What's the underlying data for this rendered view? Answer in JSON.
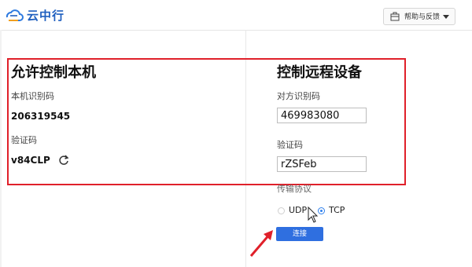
{
  "app": {
    "title": "云中行",
    "help_label": "帮助与反馈"
  },
  "local": {
    "section_title": "允许控制本机",
    "id_label": "本机识别码",
    "id_value": "206319545",
    "code_label": "验证码",
    "code_value": "v84CLP"
  },
  "remote": {
    "section_title": "控制远程设备",
    "id_label": "对方识别码",
    "id_value": "469983080",
    "code_label": "验证码",
    "code_value": "rZSFeb",
    "protocol_label": "传输协议",
    "protocols": [
      {
        "label": "UDP",
        "selected": false
      },
      {
        "label": "TCP",
        "selected": true
      }
    ],
    "connect_label": "连接"
  },
  "colors": {
    "highlight": "#e0202a",
    "accent": "#2f6fe0"
  }
}
